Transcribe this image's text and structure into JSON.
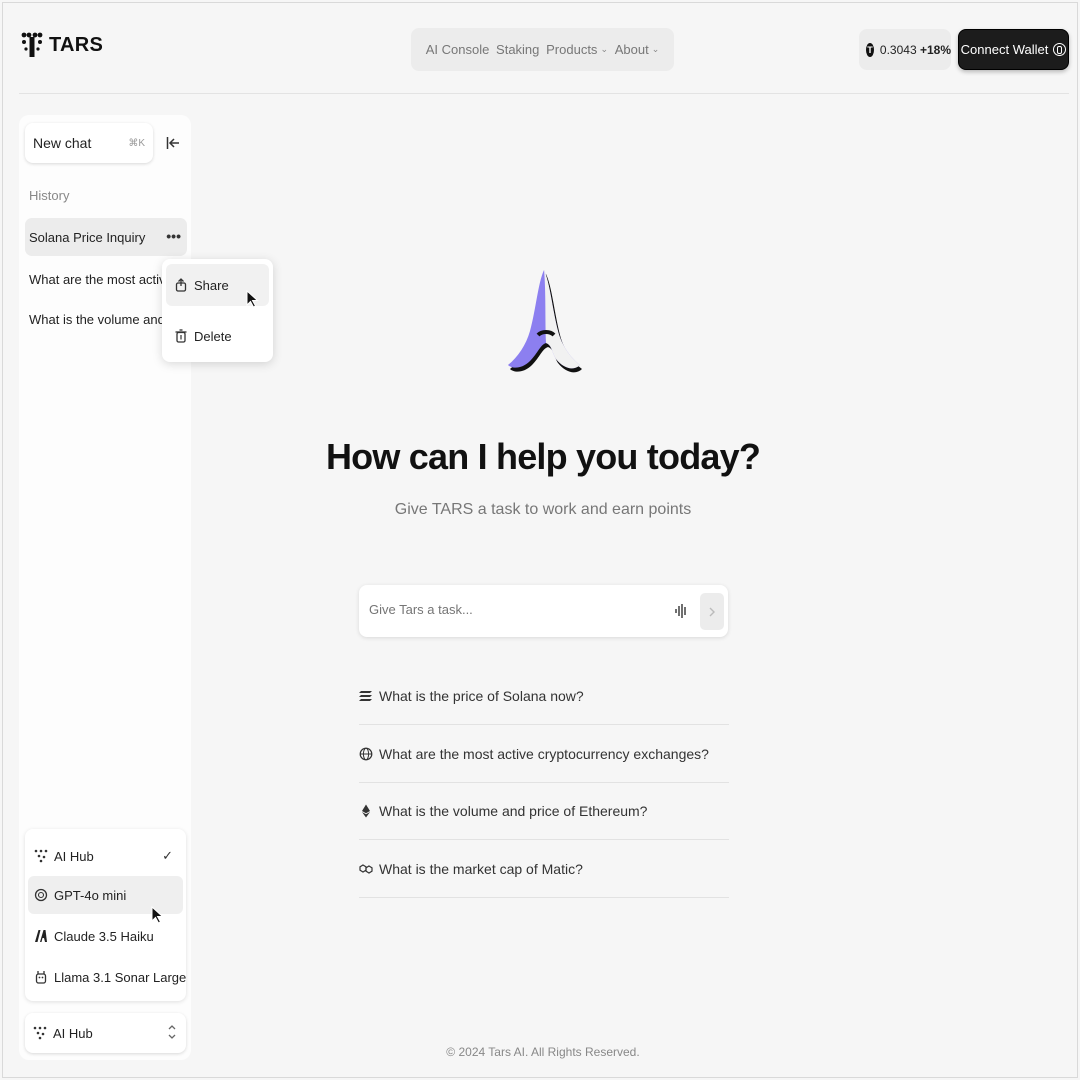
{
  "brand": {
    "name": "TARS"
  },
  "nav": {
    "items": [
      {
        "label": "AI Console",
        "has_chevron": false
      },
      {
        "label": "Staking",
        "has_chevron": false
      },
      {
        "label": "Products",
        "has_chevron": true
      },
      {
        "label": "About",
        "has_chevron": true
      }
    ],
    "chevron": "⌄"
  },
  "token": {
    "logo_letter": "T",
    "price": "0.3043",
    "change": "+18%"
  },
  "connect_wallet": {
    "label": "Connect Wallet"
  },
  "sidebar": {
    "new_chat_label": "New chat",
    "new_chat_shortcut": "⌘K",
    "history_title": "History",
    "history": [
      "Solana Price Inquiry",
      "What are the most  active...",
      "What is the volume and..."
    ],
    "more_glyph": "•••"
  },
  "context_menu": {
    "share_label": "Share",
    "delete_label": "Delete"
  },
  "models": {
    "items": [
      {
        "label": "AI Hub",
        "icon": "ai-hub-icon",
        "selected": true
      },
      {
        "label": "GPT-4o mini",
        "icon": "openai-icon",
        "selected": false
      },
      {
        "label": "Claude 3.5 Haiku",
        "icon": "anthropic-icon",
        "selected": false
      },
      {
        "label": "Llama 3.1 Sonar Large",
        "icon": "llama-icon",
        "selected": false
      }
    ],
    "check_glyph": "✓",
    "current": "AI Hub"
  },
  "main": {
    "headline": "How can I help you today?",
    "subline": "Give TARS a task to work and earn points",
    "input_placeholder": "Give Tars a task...",
    "suggestions": [
      {
        "text": "What is the price of Solana now?",
        "icon": "solana-icon"
      },
      {
        "text": "What are the most active cryptocurrency exchanges?",
        "icon": "globe-icon"
      },
      {
        "text": "What is the volume and price of Ethereum?",
        "icon": "ethereum-icon"
      },
      {
        "text": "What is the market cap of Matic?",
        "icon": "polygon-icon"
      }
    ]
  },
  "footer": {
    "copyright": "© 2024 Tars AI. All Rights Reserved."
  },
  "colors": {
    "accent": "#8c7ff0",
    "dark": "#1c1c1c",
    "background": "#f6f6f6"
  }
}
